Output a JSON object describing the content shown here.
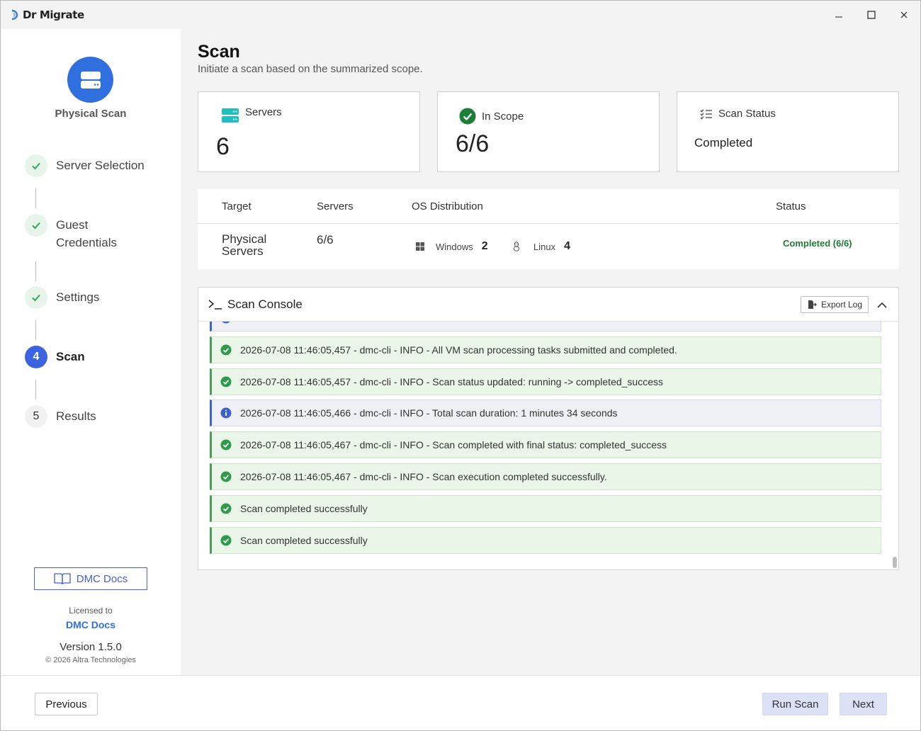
{
  "app": {
    "name": "Dr Migrate"
  },
  "sidebar": {
    "title": "Physical Scan",
    "steps": [
      {
        "number": "",
        "label": "Server Selection",
        "state": "done"
      },
      {
        "number": "",
        "label": "Guest",
        "label2": "Credentials",
        "state": "done"
      },
      {
        "number": "",
        "label": "Settings",
        "state": "done"
      },
      {
        "number": "4",
        "label": "Scan",
        "state": "active"
      },
      {
        "number": "5",
        "label": "Results",
        "state": "pending"
      }
    ],
    "docs_button": "DMC Docs",
    "licensed_label": "Licensed to",
    "licensee": "DMC Docs",
    "version": "Version 1.5.0",
    "copyright": "© 2026 Altra Technologies"
  },
  "header": {
    "title": "Scan",
    "subtitle": "Initiate a scan based on the summarized scope."
  },
  "cards": {
    "servers": {
      "label": "Servers",
      "value": "6"
    },
    "in_scope": {
      "label": "In Scope",
      "value": "6/6"
    },
    "scan_status": {
      "label": "Scan Status",
      "value": "Completed"
    }
  },
  "table": {
    "headers": [
      "Target",
      "Servers",
      "OS Distribution",
      "Status"
    ],
    "row": {
      "target_line1": "Physical",
      "target_line2": "Servers",
      "servers": "6/6",
      "os": [
        {
          "icon": "windows-icon",
          "label": "Windows",
          "count": "2"
        },
        {
          "icon": "linux-icon",
          "label": "Linux",
          "count": "4"
        }
      ],
      "status": "Completed (6/6)"
    }
  },
  "console": {
    "title": "Scan Console",
    "export_label": "Export Log",
    "entries": [
      {
        "type": "success",
        "text": "2026-07-08 11:46:05,457 - dmc-cli - INFO - All VM scan processing tasks submitted and completed."
      },
      {
        "type": "success",
        "text": "2026-07-08 11:46:05,457 - dmc-cli - INFO - Scan status updated: running -> completed_success"
      },
      {
        "type": "info",
        "text": "2026-07-08 11:46:05,466 - dmc-cli - INFO - Total scan duration: 1 minutes 34 seconds"
      },
      {
        "type": "success",
        "text": "2026-07-08 11:46:05,467 - dmc-cli - INFO - Scan completed with final status: completed_success"
      },
      {
        "type": "success",
        "text": "2026-07-08 11:46:05,467 - dmc-cli - INFO - Scan execution completed successfully."
      },
      {
        "type": "success",
        "text": "Scan completed successfully"
      },
      {
        "type": "success",
        "text": "Scan completed successfully"
      }
    ]
  },
  "footer": {
    "previous": "Previous",
    "run_scan": "Run Scan",
    "next": "Next"
  },
  "colors": {
    "accent": "#2f6fde",
    "active_step": "#3c64e0",
    "success": "#1f7a35",
    "success_bg": "#e9f6e8",
    "info": "#3d63c8"
  }
}
